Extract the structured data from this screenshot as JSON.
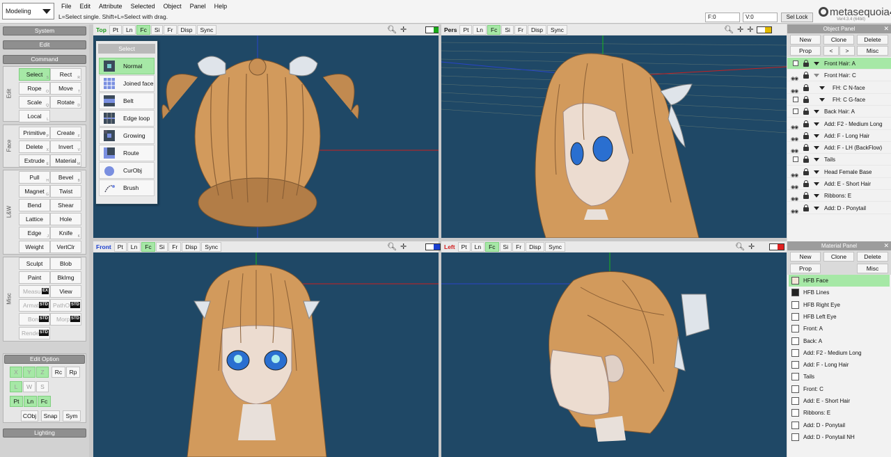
{
  "mode": "Modeling",
  "menu": [
    "File",
    "Edit",
    "Attribute",
    "Selected",
    "Object",
    "Panel",
    "Help"
  ],
  "hint": "L=Select single.  Shift+L=Select with drag.",
  "counters": {
    "faces": "F:0",
    "verts": "V:0"
  },
  "sel_lock": "Sel Lock",
  "logo": {
    "name": "metasequoia",
    "num": "4",
    "version": "Ver4.3.4 (64bit)"
  },
  "left": {
    "system": "System",
    "edit": "Edit",
    "command": "Command",
    "side_labels": {
      "edit": "Edit",
      "face": "Face",
      "lw": "L&W",
      "misc": "Misc"
    },
    "commands": {
      "select": {
        "label": "Select",
        "key": "S"
      },
      "rect": {
        "label": "Rect",
        "key": "R"
      },
      "rope": {
        "label": "Rope",
        "key": "O"
      },
      "move": {
        "label": "Move",
        "key": "T"
      },
      "scale": {
        "label": "Scale",
        "key": "Q"
      },
      "rotate": {
        "label": "Rotate",
        "key": "D"
      },
      "local": {
        "label": "Local",
        "key": "L"
      },
      "primitive": {
        "label": "Primitive",
        "key": "P"
      },
      "create": {
        "label": "Create",
        "key": "F"
      },
      "delete": {
        "label": "Delete",
        "key": "X"
      },
      "invert": {
        "label": "Invert",
        "key": "V"
      },
      "extrude": {
        "label": "Extrude",
        "key": "E"
      },
      "material": {
        "label": "Material",
        "key": "M"
      },
      "pull": {
        "label": "Pull",
        "key": "H"
      },
      "bevel": {
        "label": "Bevel",
        "key": "B"
      },
      "magnet": {
        "label": "Magnet",
        "key": "G"
      },
      "twist": {
        "label": "Twist",
        "key": ""
      },
      "bend": {
        "label": "Bend",
        "key": ""
      },
      "shear": {
        "label": "Shear",
        "key": ""
      },
      "lattice": {
        "label": "Lattice",
        "key": ""
      },
      "hole": {
        "label": "Hole",
        "key": ""
      },
      "edge": {
        "label": "Edge",
        "key": "J"
      },
      "knife": {
        "label": "Knife",
        "key": "K"
      },
      "weight": {
        "label": "Weight",
        "key": ""
      },
      "vertclr": {
        "label": "VertClr",
        "key": ""
      },
      "sculpt": {
        "label": "Sculpt",
        "key": ""
      },
      "blob": {
        "label": "Blob",
        "key": ""
      },
      "paint": {
        "label": "Paint",
        "key": ""
      },
      "bkimg": {
        "label": "BkImg",
        "key": ""
      },
      "measure": {
        "label": "Measu",
        "badge": "EX"
      },
      "view": {
        "label": "View",
        "key": ""
      },
      "armature": {
        "label": "Armat",
        "badge": "STD"
      },
      "pathobj": {
        "label": "PathOb",
        "badge": "STD"
      },
      "bone": {
        "label": "Bone",
        "badge": "STD"
      },
      "morph": {
        "label": "Morph",
        "badge": "STD"
      },
      "render": {
        "label": "Render",
        "badge": "STD"
      }
    },
    "edit_option": "Edit Option",
    "eo": {
      "x": "X",
      "y": "Y",
      "z": "Z",
      "rc": "Rc",
      "rp": "Rp",
      "l": "L",
      "w": "W",
      "s": "S",
      "pt": "Pt",
      "ln": "Ln",
      "fc": "Fc",
      "cobj": "CObj",
      "snap": "Snap",
      "sym": "Sym"
    },
    "lighting": "Lighting"
  },
  "viewports": {
    "top": {
      "name": "Top",
      "accent": "#1a9a1a",
      "mon": "#1aa81a"
    },
    "pers": {
      "name": "Pers",
      "accent": "#111111",
      "mon": "#e0b800"
    },
    "front": {
      "name": "Front",
      "accent": "#1a3fcf",
      "mon": "#1a3fcf"
    },
    "left": {
      "name": "Left",
      "accent": "#d01a1a",
      "mon": "#e02020"
    },
    "buttons": {
      "pt": "Pt",
      "ln": "Ln",
      "fc": "Fc",
      "si": "Si",
      "fr": "Fr",
      "disp": "Disp",
      "sync": "Sync"
    }
  },
  "select_popup": {
    "title": "Select",
    "items": [
      "Normal",
      "Joined face",
      "Belt",
      "Edge loop",
      "Growing",
      "Route",
      "CurObj",
      "Brush"
    ]
  },
  "object_panel": {
    "title": "Object Panel",
    "buttons": {
      "new": "New",
      "clone": "Clone",
      "delete": "Delete",
      "prop": "Prop",
      "prev": "<",
      "next": ">",
      "misc": "Misc"
    },
    "objects": [
      {
        "name": "Front Hair: A",
        "selected": true,
        "visible": false,
        "tri": "solid",
        "indent": 0
      },
      {
        "name": "Front Hair: C",
        "selected": false,
        "visible": true,
        "tri": "hollow",
        "indent": 0
      },
      {
        "name": "FH: C N-face",
        "selected": false,
        "visible": true,
        "tri": "solid",
        "indent": 1
      },
      {
        "name": "FH: C G-face",
        "selected": false,
        "visible": false,
        "tri": "solid",
        "indent": 1
      },
      {
        "name": "Back Hair: A",
        "selected": false,
        "visible": false,
        "tri": "solid",
        "indent": 0
      },
      {
        "name": "Add: F2 - Medium Long",
        "selected": false,
        "visible": true,
        "tri": "solid",
        "indent": 0
      },
      {
        "name": "Add: F - Long Hair",
        "selected": false,
        "visible": true,
        "tri": "solid",
        "indent": 0
      },
      {
        "name": "Add: F - LH (BackFlow)",
        "selected": false,
        "visible": true,
        "tri": "solid",
        "indent": 0
      },
      {
        "name": "Tails",
        "selected": false,
        "visible": false,
        "tri": "solid",
        "indent": 0
      },
      {
        "name": "Head Female Base",
        "selected": false,
        "visible": true,
        "tri": "solid",
        "indent": 0
      },
      {
        "name": "Add: E - Short Hair",
        "selected": false,
        "visible": true,
        "tri": "solid",
        "indent": 0
      },
      {
        "name": "Ribbons: E",
        "selected": false,
        "visible": true,
        "tri": "solid",
        "indent": 0
      },
      {
        "name": "Add: D - Ponytail",
        "selected": false,
        "visible": true,
        "tri": "solid",
        "indent": 0
      }
    ]
  },
  "material_panel": {
    "title": "Material Panel",
    "buttons": {
      "new": "New",
      "clone": "Clone",
      "delete": "Delete",
      "prop": "Prop",
      "misc": "Misc"
    },
    "materials": [
      {
        "name": "HFB Face",
        "color": "#f3e6d8",
        "selected": true
      },
      {
        "name": "HFB Lines",
        "color": "#222222",
        "selected": false
      },
      {
        "name": "HFB Right Eye",
        "color": "#ffffff",
        "selected": false
      },
      {
        "name": "HFB Left Eye",
        "color": "#ffffff",
        "selected": false
      },
      {
        "name": "Front: A",
        "color": "#ffffff",
        "selected": false
      },
      {
        "name": "Back: A",
        "color": "#ffffff",
        "selected": false
      },
      {
        "name": "Add: F2 - Medium Long",
        "color": "#ffffff",
        "selected": false
      },
      {
        "name": "Add: F - Long Hair",
        "color": "#ffffff",
        "selected": false
      },
      {
        "name": "Tails",
        "color": "#ffffff",
        "selected": false
      },
      {
        "name": "Front: C",
        "color": "#ffffff",
        "selected": false
      },
      {
        "name": "Add: E - Short Hair",
        "color": "#ffffff",
        "selected": false
      },
      {
        "name": "Ribbons: E",
        "color": "#ffffff",
        "selected": false
      },
      {
        "name": "Add: D - Ponytail",
        "color": "#ffffff",
        "selected": false
      },
      {
        "name": "Add: D - Ponytail NH",
        "color": "#ffffff",
        "selected": false
      }
    ]
  }
}
